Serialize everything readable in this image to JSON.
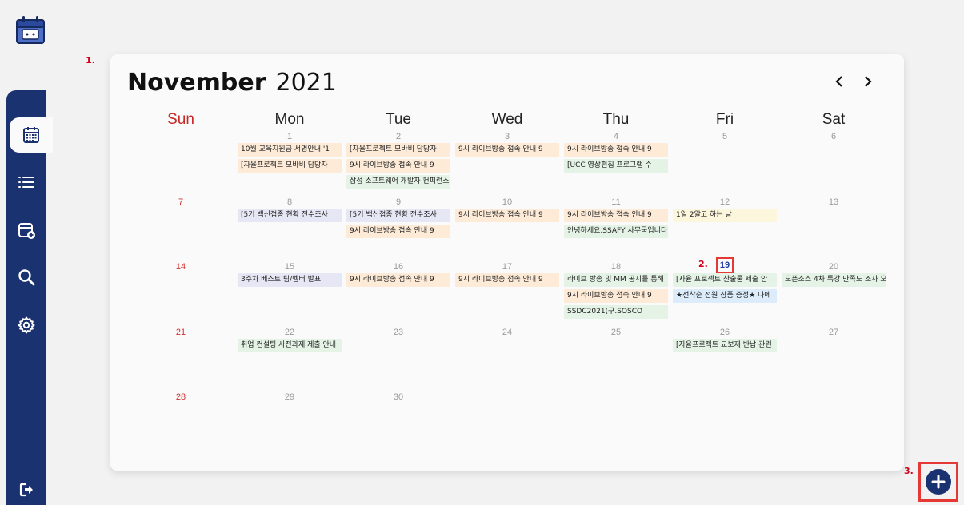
{
  "calendar": {
    "month": "November",
    "year": "2021",
    "days": [
      "Sun",
      "Mon",
      "Tue",
      "Wed",
      "Thu",
      "Fri",
      "Sat"
    ],
    "weeks": [
      [
        "",
        "1",
        "2",
        "3",
        "4",
        "5",
        "6"
      ],
      [
        "7",
        "8",
        "9",
        "10",
        "11",
        "12",
        "13"
      ],
      [
        "14",
        "15",
        "16",
        "17",
        "18",
        "19",
        "20"
      ],
      [
        "21",
        "22",
        "23",
        "24",
        "25",
        "26",
        "27"
      ],
      [
        "28",
        "29",
        "30",
        "",
        "",
        "",
        ""
      ]
    ],
    "today": "19"
  },
  "events": [
    {
      "week": 0,
      "day": 1,
      "slot": 0,
      "text": "10월 교육지원금 서명안내 '1",
      "color": "orange"
    },
    {
      "week": 0,
      "day": 1,
      "slot": 1,
      "text": "[자율프로젝트 모바비 담당자",
      "color": "orange"
    },
    {
      "week": 0,
      "day": 2,
      "slot": 0,
      "text": "[자율프로젝트 모바비 담당자",
      "color": "orange"
    },
    {
      "week": 0,
      "day": 2,
      "slot": 1,
      "text": "9시 라이브방송 접속 안내 9",
      "color": "orange"
    },
    {
      "week": 0,
      "day": 2,
      "slot": 2,
      "text": "삼성 소프트웨어 개발자 컨퍼런스",
      "color": "green"
    },
    {
      "week": 0,
      "day": 3,
      "slot": 0,
      "text": "9시 라이브방송 접속 안내 9",
      "color": "orange"
    },
    {
      "week": 0,
      "day": 4,
      "slot": 0,
      "text": "9시 라이브방송 접속 안내 9",
      "color": "orange"
    },
    {
      "week": 0,
      "day": 4,
      "slot": 1,
      "text": "[UCC 영상편집 프로그램 수",
      "color": "green"
    },
    {
      "week": 1,
      "day": 1,
      "slot": 0,
      "text": "[5기 백신접종 현황 전수조사",
      "color": "purple"
    },
    {
      "week": 1,
      "day": 2,
      "slot": 0,
      "text": "[5기 백신접종 현황 전수조사",
      "color": "purple"
    },
    {
      "week": 1,
      "day": 2,
      "slot": 1,
      "text": "9시 라이브방송 접속 안내 9",
      "color": "orange"
    },
    {
      "week": 1,
      "day": 3,
      "slot": 0,
      "text": "9시 라이브방송 접속 안내 9",
      "color": "orange"
    },
    {
      "week": 1,
      "day": 4,
      "slot": 0,
      "text": "9시 라이브방송 접속 안내 9",
      "color": "orange"
    },
    {
      "week": 1,
      "day": 4,
      "slot": 1,
      "text": "안녕하세요.SSAFY 사무국입니다",
      "color": "green"
    },
    {
      "week": 1,
      "day": 5,
      "slot": 0,
      "text": "1일 2알고 하는 날",
      "color": "yellow"
    },
    {
      "week": 2,
      "day": 1,
      "slot": 0,
      "text": "3주차 베스트 팀/멤버 발표",
      "color": "purple"
    },
    {
      "week": 2,
      "day": 2,
      "slot": 0,
      "text": "9시 라이브방송 접속 안내 9",
      "color": "orange"
    },
    {
      "week": 2,
      "day": 3,
      "slot": 0,
      "text": "9시 라이브방송 접속 안내 9",
      "color": "orange"
    },
    {
      "week": 2,
      "day": 4,
      "slot": 0,
      "text": "라이브 방송 및 MM 공지를 통해",
      "color": "green"
    },
    {
      "week": 2,
      "day": 4,
      "slot": 1,
      "text": "9시 라이브방송 접속 안내 9",
      "color": "orange"
    },
    {
      "week": 2,
      "day": 4,
      "slot": 2,
      "text": "SSDC2021(구.SOSCO",
      "color": "green"
    },
    {
      "week": 2,
      "day": 5,
      "slot": 0,
      "text": "[자율 프로젝트 산출물 제출 안",
      "color": "green"
    },
    {
      "week": 2,
      "day": 5,
      "slot": 1,
      "text": "★선착순 전원 상품 증정★ 나에",
      "color": "blue"
    },
    {
      "week": 2,
      "day": 6,
      "slot": 0,
      "text": "오픈소스 4차 특강 만족도 조사 오",
      "color": "green"
    },
    {
      "week": 3,
      "day": 1,
      "slot": 0,
      "text": "취업 컨설팅 사전과제 제출 안내",
      "color": "green"
    },
    {
      "week": 3,
      "day": 5,
      "slot": 0,
      "text": "[자율프로젝트 교보재 반납 관련",
      "color": "green"
    }
  ],
  "annotations": {
    "a1": "1.",
    "a2": "2.",
    "a3": "3."
  },
  "colors": {
    "navy": "#1a3370",
    "sunday": "#c62828",
    "highlight": "#e53935"
  },
  "icons": {
    "logo": "calendar-app-logo-icon",
    "nav": [
      "calendar-icon",
      "list-icon",
      "calendar-add-icon",
      "search-icon",
      "gear-icon"
    ],
    "logout": "logout-icon",
    "prev": "chevron-left-icon",
    "next": "chevron-right-icon",
    "add": "plus-icon"
  }
}
